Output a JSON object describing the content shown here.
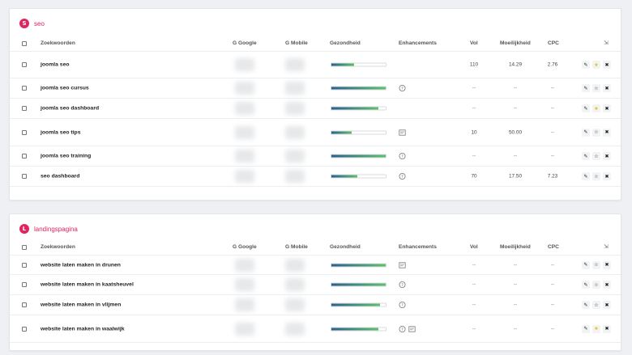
{
  "columns": {
    "keyword": "Zoekwoorden",
    "google": "G Google",
    "mobile": "G Mobile",
    "health": "Gezondheid",
    "enhancements": "Enhancements",
    "vol": "Vol",
    "difficulty": "Moeilijkheid",
    "cpc": "CPC"
  },
  "colors": {
    "badge": "#e0245e",
    "title": "#e0245e",
    "health_gradient_start": "#2b5f8f",
    "health_gradient_end": "#5dc16c"
  },
  "groups": [
    {
      "badge": "S",
      "title": "seo",
      "rows": [
        {
          "keyword": "joomla seo",
          "health": 0.42,
          "enhancements": [],
          "vol": "110",
          "difficulty": "14.29",
          "cpc": "2.76",
          "starred": true
        },
        {
          "keyword": "joomla seo cursus",
          "health": 1.0,
          "enhancements": [
            "faq-icon"
          ],
          "vol": "--",
          "difficulty": "--",
          "cpc": "--",
          "starred": false
        },
        {
          "keyword": "joomla seo dashboard",
          "health": 0.86,
          "enhancements": [],
          "vol": "--",
          "difficulty": "--",
          "cpc": "--",
          "starred": true
        },
        {
          "keyword": "joomla seo tips",
          "health": 0.38,
          "enhancements": [
            "image-icon"
          ],
          "vol": "10",
          "difficulty": "50.00",
          "cpc": "--",
          "starred": false
        },
        {
          "keyword": "joomla seo training",
          "health": 1.0,
          "enhancements": [
            "faq-icon"
          ],
          "vol": "--",
          "difficulty": "--",
          "cpc": "--",
          "starred": false
        },
        {
          "keyword": "seo dashboard",
          "health": 0.48,
          "enhancements": [
            "faq-icon"
          ],
          "vol": "70",
          "difficulty": "17.50",
          "cpc": "7.23",
          "starred": false
        }
      ]
    },
    {
      "badge": "L",
      "title": "landingspagina",
      "rows": [
        {
          "keyword": "website laten maken in drunen",
          "health": 1.0,
          "enhancements": [
            "image-icon"
          ],
          "vol": "--",
          "difficulty": "--",
          "cpc": "--",
          "starred": false
        },
        {
          "keyword": "website laten maken in kaatsheuvel",
          "health": 1.0,
          "enhancements": [
            "faq-icon"
          ],
          "vol": "--",
          "difficulty": "--",
          "cpc": "--",
          "starred": false
        },
        {
          "keyword": "website laten maken in vlijmen",
          "health": 0.9,
          "enhancements": [
            "faq-icon"
          ],
          "vol": "--",
          "difficulty": "--",
          "cpc": "--",
          "starred": false
        },
        {
          "keyword": "website laten maken in waalwijk",
          "health": 0.86,
          "enhancements": [
            "faq-icon",
            "image-icon"
          ],
          "vol": "--",
          "difficulty": "--",
          "cpc": "--",
          "starred": true
        }
      ]
    }
  ]
}
